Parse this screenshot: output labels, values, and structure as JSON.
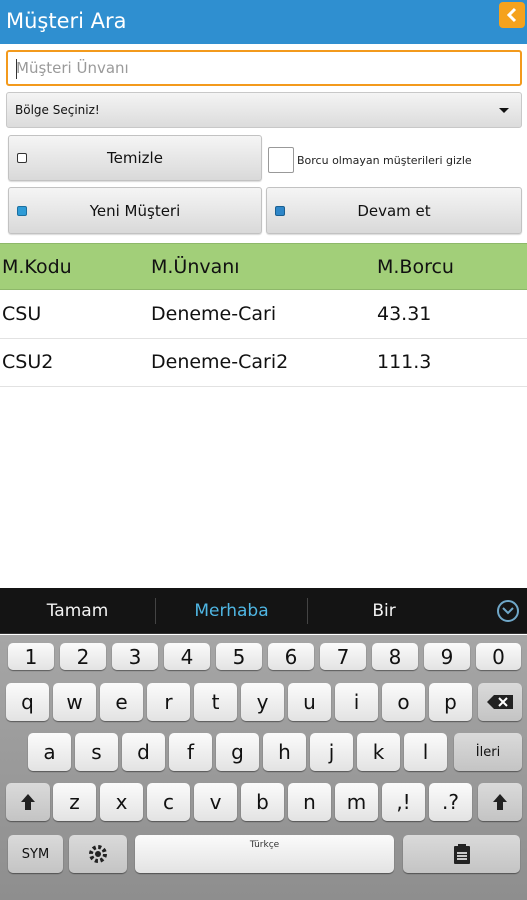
{
  "header": {
    "title": "Müşteri Ara",
    "back_icon": "chevron-left-icon",
    "accent": "#f5a21d",
    "bar_color": "#2f8fd0"
  },
  "search": {
    "placeholder": "Müşteri Ünvanı",
    "value": ""
  },
  "region": {
    "selected": "Bölge Seçiniz!"
  },
  "buttons": {
    "clear": "Temizle",
    "new_customer": "Yeni Müşteri",
    "continue": "Devam et"
  },
  "filter": {
    "label": "Borcu olmayan müşterileri gizle",
    "checked": false
  },
  "table": {
    "header_color": "#a2cf79",
    "columns": [
      "M.Kodu",
      "M.Ünvanı",
      "M.Borcu"
    ],
    "rows": [
      [
        "CSU",
        "Deneme-Cari",
        "43.31"
      ],
      [
        "CSU2",
        "Deneme-Cari2",
        "111.3"
      ]
    ]
  },
  "keyboard": {
    "suggestions": [
      "Tamam",
      "Merhaba",
      "Bir"
    ],
    "highlight_color": "#4fb6e3",
    "row_numbers": [
      "1",
      "2",
      "3",
      "4",
      "5",
      "6",
      "7",
      "8",
      "9",
      "0"
    ],
    "row1": [
      "q",
      "w",
      "e",
      "r",
      "t",
      "y",
      "u",
      "i",
      "o",
      "p"
    ],
    "row2": [
      "a",
      "s",
      "d",
      "f",
      "g",
      "h",
      "j",
      "k",
      "l"
    ],
    "row3": [
      "z",
      "x",
      "c",
      "v",
      "b",
      "n",
      "m"
    ],
    "punct1": ",!",
    "punct2": ".?",
    "enter_label": "İleri",
    "sym_label": "SYM",
    "space_label": "Türkçe"
  }
}
